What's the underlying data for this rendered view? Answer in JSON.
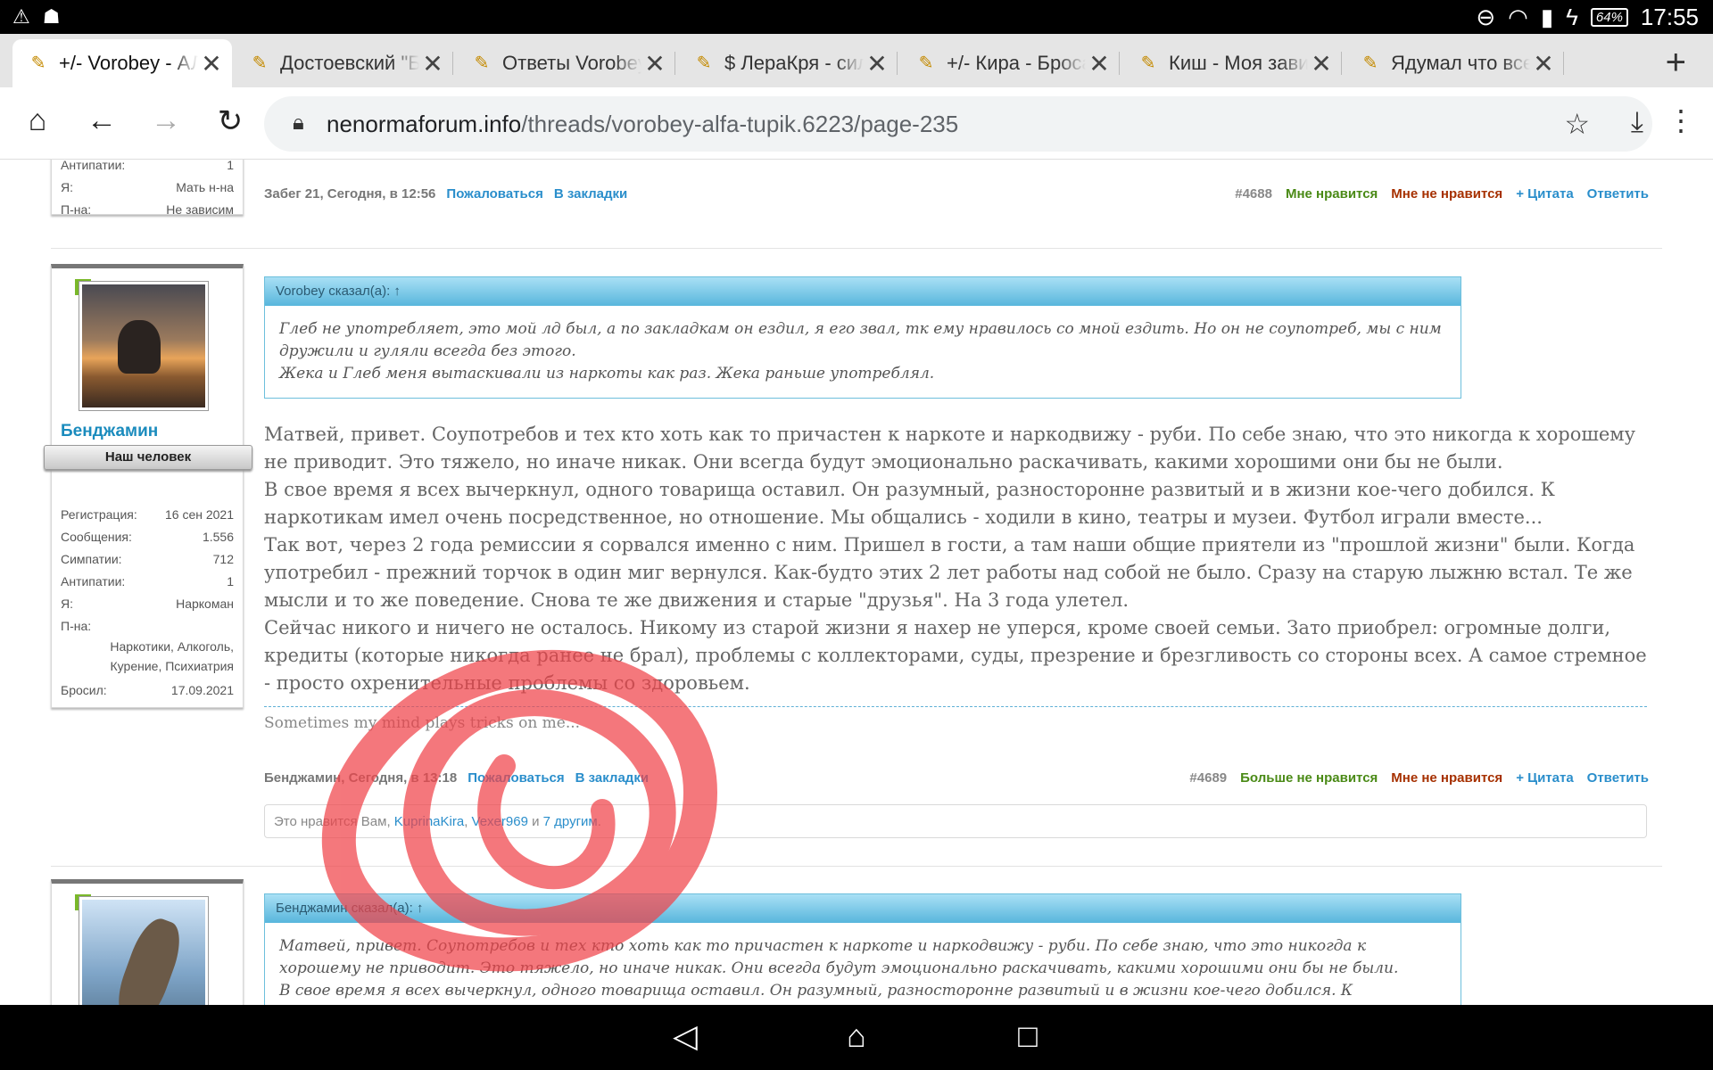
{
  "status_bar": {
    "time": "17:55",
    "battery": "64%",
    "left_icons": [
      "warning-icon",
      "person-icon"
    ],
    "right_icons": [
      "dnd-icon",
      "wifi-icon",
      "sim-icon",
      "charging-icon"
    ]
  },
  "tabs": [
    {
      "title": "+/- Vorobey - АЛ"
    },
    {
      "title": "Достоевский \"Б"
    },
    {
      "title": "Ответы Vorobey"
    },
    {
      "title": "$ ЛераКря - сил"
    },
    {
      "title": "+/- Кира - Броса"
    },
    {
      "title": "Киш - Моя зави"
    },
    {
      "title": "Ядумал что все"
    }
  ],
  "toolbar": {
    "url_domain": "nenormaforum.info",
    "url_path": "/threads/vorobey-alfa-tupik.6223/page-235"
  },
  "post_prev": {
    "fields": [
      {
        "k": "Антипатии:",
        "v": "1"
      },
      {
        "k": "Я:",
        "v": "Мать н-на"
      },
      {
        "k": "П-на:",
        "v": "Не зависим"
      }
    ],
    "author_date": "Забег 21, Сегодня, в 12:56",
    "report": "Пожаловаться",
    "bookmark": "В закладки",
    "num": "#4688",
    "like": "Мне нравится",
    "dislike": "Мне не нравится",
    "quote": "+ Цитата",
    "reply": "Ответить"
  },
  "post_main": {
    "username": "Бенджамин",
    "user_title": "Наш человек",
    "fields": [
      {
        "k": "Регистрация:",
        "v": "16 сен 2021"
      },
      {
        "k": "Сообщения:",
        "v": "1.556"
      },
      {
        "k": "Симпатии:",
        "v": "712"
      },
      {
        "k": "Антипатии:",
        "v": "1"
      },
      {
        "k": "Я:",
        "v": "Наркоман"
      }
    ],
    "pna_label": "П-на:",
    "pna_value": "Наркотики, Алкоголь, Курение, Психиатрия",
    "quit_label": "Бросил:",
    "quit_value": "17.09.2021",
    "quote_head": "Vorobey сказал(а): ↑",
    "quote_lines": [
      "Глеб не употребляет, это мой лд был, а по закладкам он ездил, я его звал, тк ему нравилось со мной ездить. Но он не соупотреб, мы с ним дружили и гуляли всегда без этого.",
      "Жека и Глеб меня вытаскивали из наркоты как раз. Жека раньше употреблял."
    ],
    "paragraphs": [
      "Матвей, привет. Соупотребов и тех кто хоть как то причастен к наркоте и наркодвижу - руби. По себе знаю, что это никогда к хорошему не приводит. Это тяжело, но иначе никак. Они всегда будут эмоционально раскачивать, какими хорошими они бы не были.",
      "В свое время я всех вычеркнул, одного товарища оставил. Он разумный, разносторонне развитый и в жизни кое-чего добился. К наркотикам имел очень посредственное, но отношение. Мы общались - ходили в кино, театры и музеи. Футбол играли вместе...",
      "Так вот, через 2 года ремиссии я сорвался именно с ним. Пришел в гости, а там наши общие приятели из \"прошлой жизни\" были. Когда употребил - прежний торчок в один миг вернулся. Как-будто этих 2 лет работы над собой не было. Сразу на старую лыжню встал. Те же мысли и то же поведение. Снова те же движения и старые \"друзья\". На 3 года улетел.",
      "Сейчас никого и ничего не осталось. Никому из старой жизни я нахер не уперся, кроме своей семьи. Зато приобрел: огромные долги, кредиты (которые никогда ранее не брал), проблемы с коллекторами, суды, презрение и брезгливость со стороны всех. А самое стремное - просто охренительные проблемы со здоровьем."
    ],
    "signature": "Sometimes my mind plays tricks on me...",
    "author_date": "Бенджамин, Сегодня, в 13:18",
    "report": "Пожаловаться",
    "bookmark": "В закладки",
    "num": "#4689",
    "like": "Больше не нравится",
    "dislike": "Мне не нравится",
    "quote": "+ Цитата",
    "reply": "Ответить",
    "likes_prefix": "Это нравится Вам, ",
    "likes_user1": "KuprinaKira",
    "likes_sep": ", ",
    "likes_user2": "Vexer969",
    "likes_and": " и ",
    "likes_others": "7 другим",
    "likes_end": "."
  },
  "post_next": {
    "quote_head": "Бенджамин сказал(а): ↑",
    "quote_lines": [
      "Матвей, привет. Соупотребов и тех кто хоть как то причастен к наркоте и наркодвижу - руби. По себе знаю, что это никогда к хорошему не приводит. Это тяжело, но иначе никак. Они всегда будут эмоционально раскачивать, какими хорошими они бы не были.",
      "В свое время я всех вычеркнул, одного товарища оставил. Он разумный, разносторонне развитый и в жизни кое-чего добился. К наркотикам"
    ]
  },
  "annotation_color": "#f0444a"
}
